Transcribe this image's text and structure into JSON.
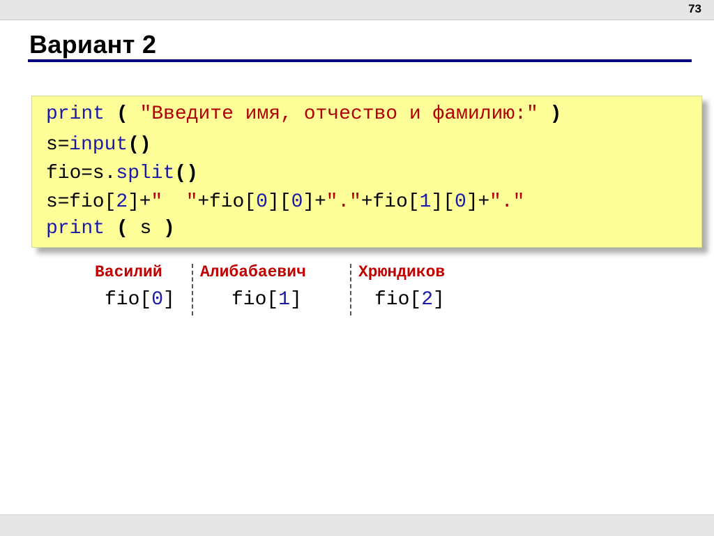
{
  "slide": {
    "page_number": "73",
    "title": "Вариант 2"
  },
  "code": {
    "line1": {
      "fn": "print",
      "open": "(",
      "str": "\"Введите имя, отчество и фамилию:\"",
      "close": ")"
    },
    "line2": {
      "var": "s",
      "eq": "=",
      "fn": "input",
      "parens": "()"
    },
    "line3": {
      "var": "fio",
      "eq": "=",
      "obj": "s.",
      "fn": "split",
      "parens": "()"
    },
    "line4": {
      "var": "s",
      "eq": "=",
      "t1": "fio[",
      "n1": "2",
      "t2": "]",
      "p1": "+",
      "s1": "\"  \"",
      "p2": "+",
      "t3": "fio[",
      "n2": "0",
      "t4": "][",
      "n3": "0",
      "t5": "]",
      "p3": "+",
      "s2": "\".\"",
      "p4": "+",
      "t6": "fio[",
      "n4": "1",
      "t7": "][",
      "n5": "0",
      "t8": "]",
      "p5": "+",
      "s3": "\".\""
    },
    "line5": {
      "fn": "print",
      "open": "(",
      "arg": "s",
      "close": ")"
    }
  },
  "parts": [
    {
      "name": "Василий",
      "index_prefix": "fio[",
      "index": "0",
      "index_suffix": "]"
    },
    {
      "name": "Алибабаевич",
      "index_prefix": "fio[",
      "index": "1",
      "index_suffix": "]"
    },
    {
      "name": "Хрюндиков",
      "index_prefix": "fio[",
      "index": "2",
      "index_suffix": "]"
    }
  ],
  "colors": {
    "keyword": "#1a1aa6",
    "string": "#b00000",
    "name_label": "#c00000",
    "code_background": "#ffff99",
    "title_rule": "#00007a"
  }
}
